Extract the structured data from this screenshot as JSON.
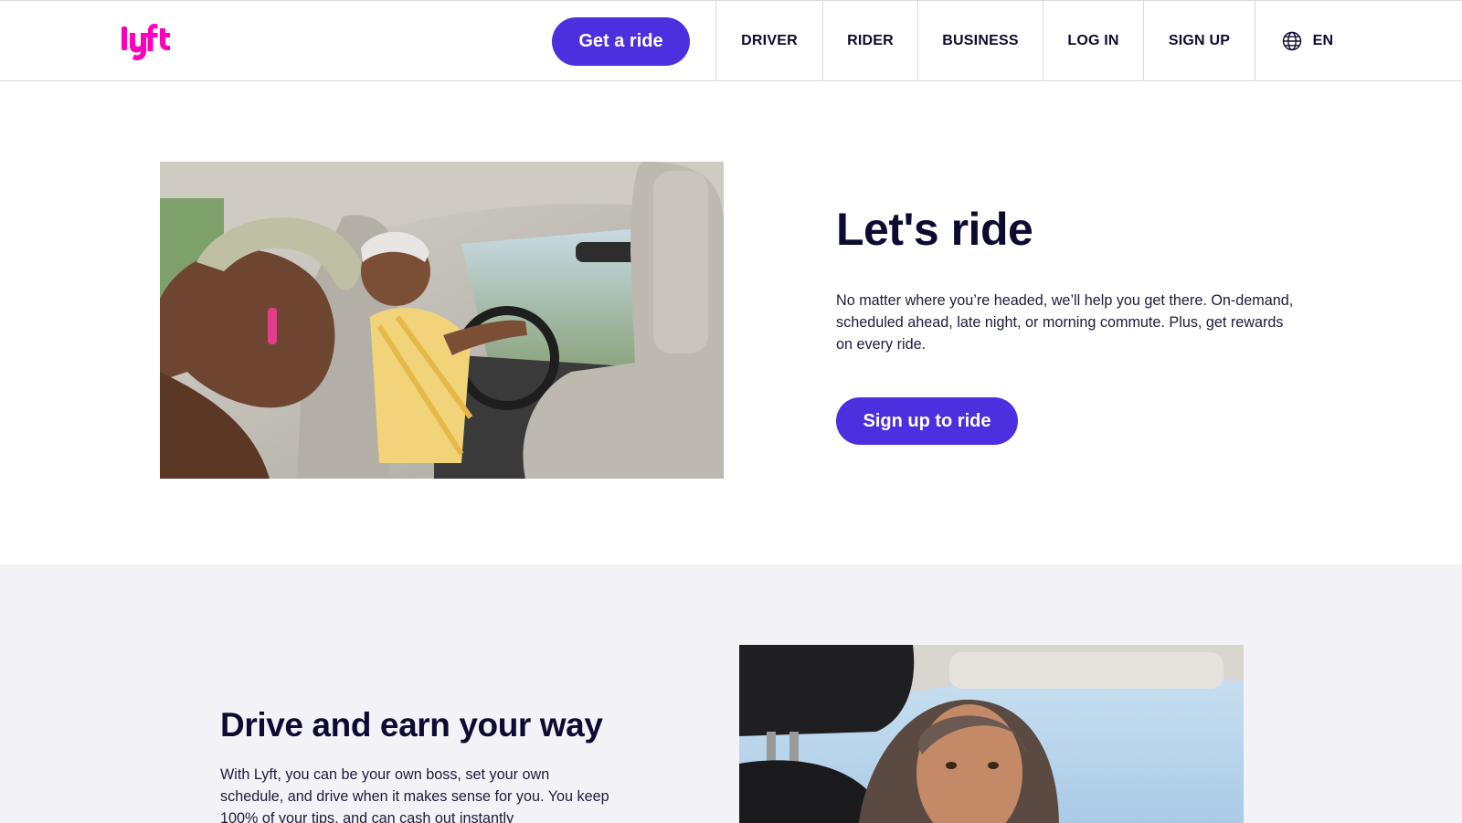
{
  "header": {
    "logo_alt": "lyft",
    "get_ride_label": "Get a ride",
    "nav": [
      {
        "label": "DRIVER"
      },
      {
        "label": "RIDER"
      },
      {
        "label": "BUSINESS"
      },
      {
        "label": "LOG IN"
      },
      {
        "label": "SIGN UP"
      }
    ],
    "language": {
      "label": "EN",
      "icon": "globe-icon"
    }
  },
  "hero": {
    "title": "Let's ride",
    "text": "No matter where you’re headed, we’ll help you get there. On-demand, scheduled ahead, late night, or morning commute. Plus, get rewards on every ride.",
    "button_label": "Sign up to ride",
    "image": "riders-in-car-photo"
  },
  "drive": {
    "title": "Drive and earn your way",
    "text": "With Lyft, you can be your own boss, set your own schedule, and drive when it makes sense for you. You keep 100% of your tips, and can cash out instantly",
    "image": "driver-in-car-photo"
  },
  "colors": {
    "brand_pink": "#ff00bf",
    "primary_purple": "#4c2fdf",
    "text_dark": "#0c0b31",
    "section_gray": "#f3f3f7"
  }
}
